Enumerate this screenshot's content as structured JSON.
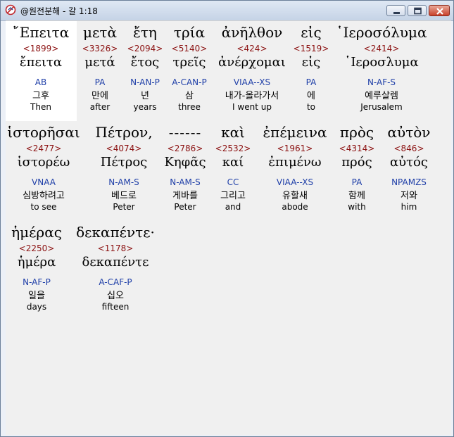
{
  "window": {
    "title": "@원전분해 - 갈 1:18"
  },
  "rows": [
    {
      "words": [
        {
          "greek": "῎Επειτα",
          "strong": "<1899>",
          "lemma": "ἔπειτα",
          "parse": "AB",
          "korean": "그후",
          "english": "Then"
        },
        {
          "greek": "μετὰ",
          "strong": "<3326>",
          "lemma": "μετά",
          "parse": "PA",
          "korean": "만에",
          "english": "after"
        },
        {
          "greek": "ἔτη",
          "strong": "<2094>",
          "lemma": "ἔτος",
          "parse": "N-AN-P",
          "korean": "년",
          "english": "years"
        },
        {
          "greek": "τρία",
          "strong": "<5140>",
          "lemma": "τρεῖς",
          "parse": "A-CAN-P",
          "korean": "삼",
          "english": "three"
        },
        {
          "greek": "ἀνῆλθον",
          "strong": "<424>",
          "lemma": "ἀνέρχομαι",
          "parse": "VIAA--XS",
          "korean": "내가-올라가서",
          "english": "I went up"
        },
        {
          "greek": "εἰς",
          "strong": "<1519>",
          "lemma": "εἰς",
          "parse": "PA",
          "korean": "에",
          "english": "to"
        },
        {
          "greek": "῾Ιεροσόλυμα",
          "strong": "<2414>",
          "lemma": "῾Ιεροσλυμα",
          "parse": "N-AF-S",
          "korean": "예루살렘",
          "english": "Jerusalem"
        }
      ]
    },
    {
      "words": [
        {
          "greek": "ἱστορῆσαι",
          "strong": "<2477>",
          "lemma": "ἱστορέω",
          "parse": "VNAA",
          "korean": "심방하려고",
          "english": "to see"
        },
        {
          "greek": "Πέτρον,",
          "strong": "<4074>",
          "lemma": "Πέτρος",
          "parse": "N-AM-S",
          "korean": "베드로",
          "english": "Peter"
        },
        {
          "greek": "------",
          "strong": "<2786>",
          "lemma": "Κηφᾶς",
          "parse": "N-AM-S",
          "korean": "게바를",
          "english": "Peter"
        },
        {
          "greek": "καὶ",
          "strong": "<2532>",
          "lemma": "καί",
          "parse": "CC",
          "korean": "그리고",
          "english": "and"
        },
        {
          "greek": "ἐπέμεινα",
          "strong": "<1961>",
          "lemma": "ἐπιμένω",
          "parse": "VIAA--XS",
          "korean": "유할새",
          "english": "abode"
        },
        {
          "greek": "πρὸς",
          "strong": "<4314>",
          "lemma": "πρός",
          "parse": "PA",
          "korean": "함께",
          "english": "with"
        },
        {
          "greek": "αὐτὸν",
          "strong": "<846>",
          "lemma": "αὐτός",
          "parse": "NPAMZS",
          "korean": "저와",
          "english": "him"
        }
      ]
    },
    {
      "words": [
        {
          "greek": "ἡμέρας",
          "strong": "<2250>",
          "lemma": "ἡμέρα",
          "parse": "N-AF-P",
          "korean": "일을",
          "english": "days"
        },
        {
          "greek": "δεκαπέντε·",
          "strong": "<1178>",
          "lemma": "δεκαπέντε",
          "parse": "A-CAF-P",
          "korean": "십오",
          "english": "fifteen"
        }
      ]
    }
  ]
}
